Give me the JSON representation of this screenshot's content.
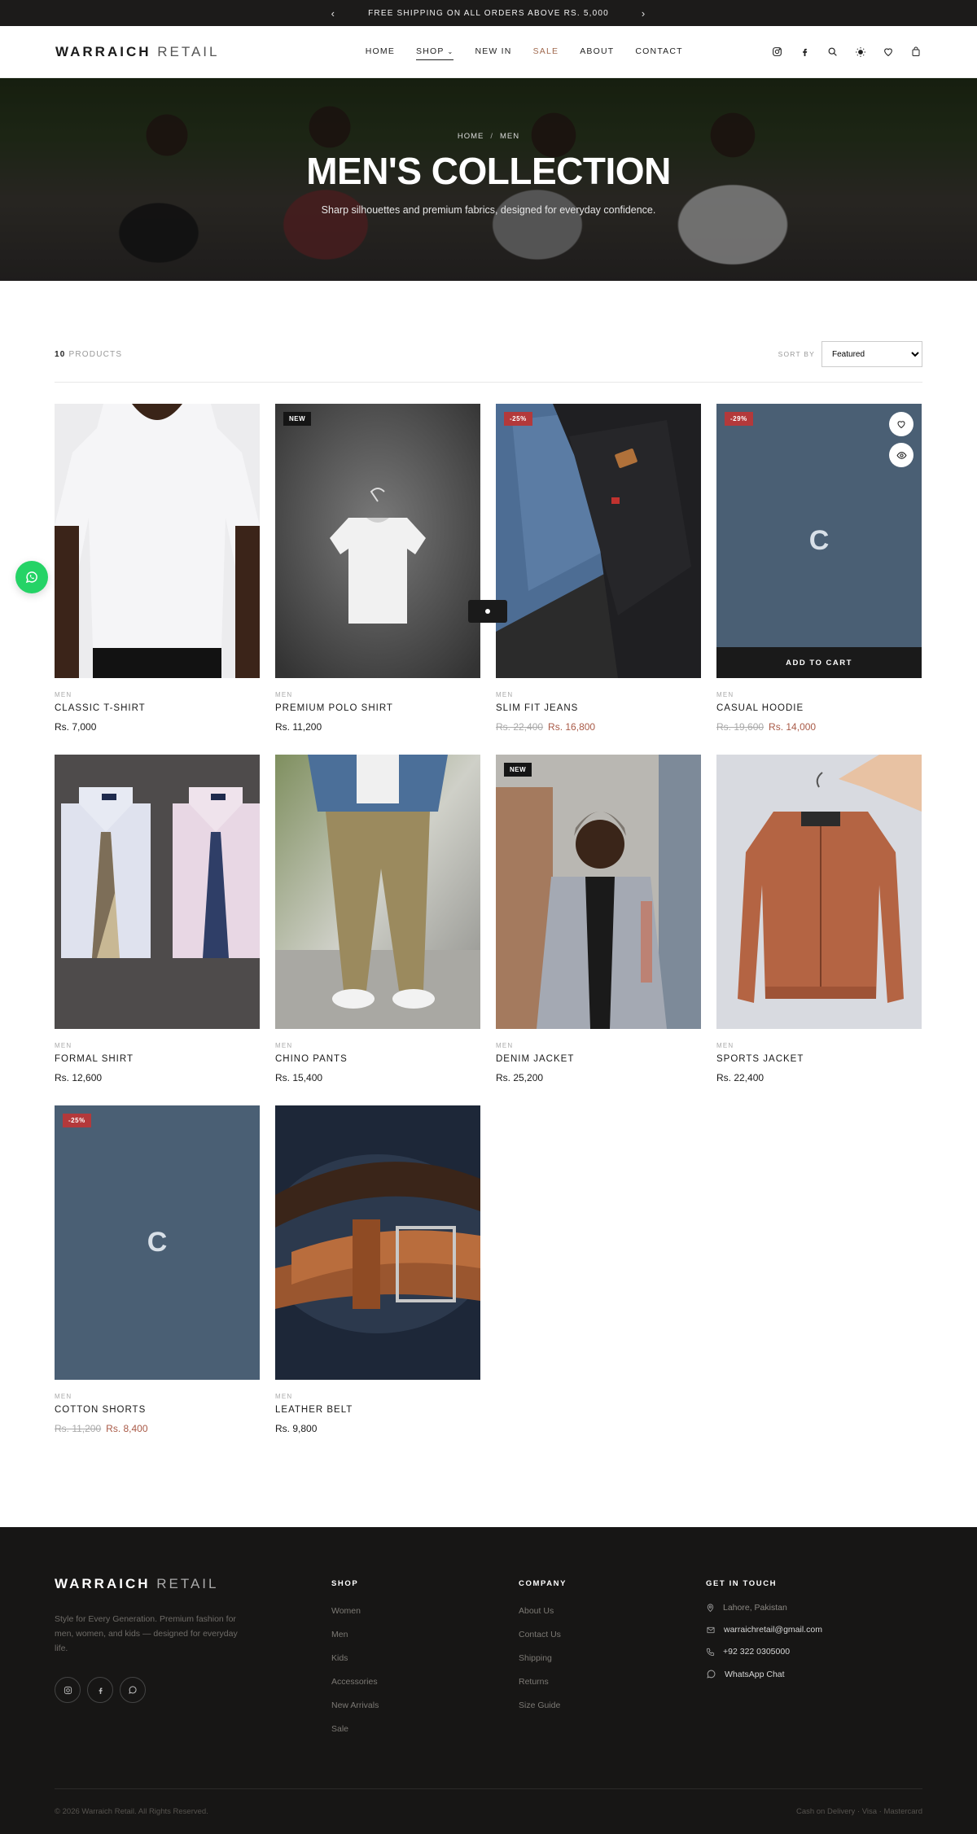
{
  "announcement": {
    "text": "FREE SHIPPING ON ALL ORDERS ABOVE RS. 5,000",
    "prev": "‹",
    "next": "›"
  },
  "header": {
    "logo_bold": "WARRAICH",
    "logo_light": "RETAIL",
    "nav": {
      "home": "HOME",
      "shop": "SHOP",
      "new_in": "NEW IN",
      "sale": "SALE",
      "about": "ABOUT",
      "contact": "CONTACT"
    }
  },
  "hero": {
    "breadcrumb_home": "HOME",
    "breadcrumb_sep": "/",
    "breadcrumb_current": "MEN",
    "title": "MEN'S COLLECTION",
    "subtitle": "Sharp silhouettes and premium fabrics, designed for everyday confidence."
  },
  "toolbar": {
    "count": "10",
    "count_label": "PRODUCTS",
    "sort_label": "SORT BY",
    "sort_value": "Featured"
  },
  "products": [
    {
      "category": "MEN",
      "name": "CLASSIC T-SHIRT",
      "price": "Rs. 7,000",
      "old_price": "",
      "badge": ""
    },
    {
      "category": "MEN",
      "name": "PREMIUM POLO SHIRT",
      "price": "Rs. 11,200",
      "old_price": "",
      "badge": "NEW"
    },
    {
      "category": "MEN",
      "name": "SLIM FIT JEANS",
      "price": "Rs. 16,800",
      "old_price": "Rs. 22,400",
      "badge": "-25%"
    },
    {
      "category": "MEN",
      "name": "CASUAL HOODIE",
      "price": "Rs. 14,000",
      "old_price": "Rs. 19,600",
      "badge": "-29%",
      "placeholder_letter": "C",
      "add_to_cart": "ADD TO CART"
    },
    {
      "category": "MEN",
      "name": "FORMAL SHIRT",
      "price": "Rs. 12,600",
      "old_price": "",
      "badge": ""
    },
    {
      "category": "MEN",
      "name": "CHINO PANTS",
      "price": "Rs. 15,400",
      "old_price": "",
      "badge": ""
    },
    {
      "category": "MEN",
      "name": "DENIM JACKET",
      "price": "Rs. 25,200",
      "old_price": "",
      "badge": "NEW"
    },
    {
      "category": "MEN",
      "name": "SPORTS JACKET",
      "price": "Rs. 22,400",
      "old_price": "",
      "badge": ""
    },
    {
      "category": "MEN",
      "name": "COTTON SHORTS",
      "price": "Rs. 8,400",
      "old_price": "Rs. 11,200",
      "badge": "-25%",
      "placeholder_letter": "C"
    },
    {
      "category": "MEN",
      "name": "LEATHER BELT",
      "price": "Rs. 9,800",
      "old_price": "",
      "badge": ""
    }
  ],
  "footer": {
    "logo_bold": "WARRAICH",
    "logo_light": "RETAIL",
    "tagline": "Style for Every Generation. Premium fashion for men, women, and kids — designed for everyday life.",
    "shop_heading": "SHOP",
    "shop_links": [
      "Women",
      "Men",
      "Kids",
      "Accessories",
      "New Arrivals",
      "Sale"
    ],
    "company_heading": "COMPANY",
    "company_links": [
      "About Us",
      "Contact Us",
      "Shipping",
      "Returns",
      "Size Guide"
    ],
    "contact_heading": "GET IN TOUCH",
    "location": "Lahore, Pakistan",
    "email": "warraichretail@gmail.com",
    "phone": "+92 322 0305000",
    "whatsapp": "WhatsApp Chat",
    "copyright": "© 2026 Warraich Retail. All Rights Reserved.",
    "payments": "Cash on Delivery · Visa · Mastercard"
  },
  "colors": {
    "accent_sale": "#a95a47",
    "badge_sale": "#b3393b",
    "dark": "#1a1a1a",
    "whatsapp": "#25d366"
  },
  "icons": [
    "instagram-icon",
    "facebook-icon",
    "search-icon",
    "theme-toggle-icon",
    "heart-icon",
    "bag-icon",
    "eye-icon",
    "whatsapp-icon",
    "location-icon",
    "mail-icon",
    "phone-icon"
  ]
}
